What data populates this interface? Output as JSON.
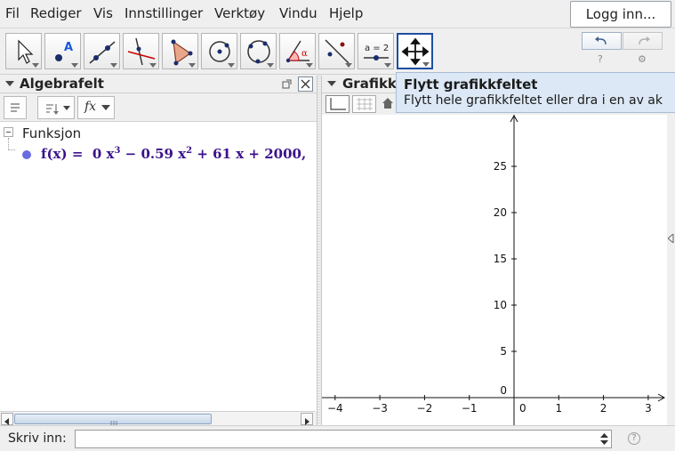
{
  "menubar": {
    "items": [
      "Fil",
      "Rediger",
      "Vis",
      "Innstillinger",
      "Verktøy",
      "Vindu",
      "Hjelp"
    ],
    "login_label": "Logg inn..."
  },
  "toolbar": {
    "tools": [
      {
        "name": "move-tool",
        "icon": "arrow-pointer-icon"
      },
      {
        "name": "point-tool",
        "icon": "point-A-icon"
      },
      {
        "name": "line-tool",
        "icon": "line-through-points-icon"
      },
      {
        "name": "perpendicular-tool",
        "icon": "perpendicular-line-icon"
      },
      {
        "name": "polygon-tool",
        "icon": "polygon-icon"
      },
      {
        "name": "circle-center-tool",
        "icon": "circle-center-point-icon"
      },
      {
        "name": "circle-three-points-tool",
        "icon": "circle-three-points-icon"
      },
      {
        "name": "angle-tool",
        "icon": "angle-alpha-icon"
      },
      {
        "name": "reflect-tool",
        "icon": "reflect-about-line-icon"
      },
      {
        "name": "slider-tool",
        "icon": "slider-a-equals-2-icon",
        "label": "a = 2"
      },
      {
        "name": "move-graphics-view-tool",
        "icon": "move-arrows-icon",
        "selected": true
      }
    ],
    "help_icon": "?",
    "settings_icon": "⚙"
  },
  "algebra": {
    "title": "Algebrafelt",
    "category": "Funksjon",
    "formula": {
      "lhs": "f(x)",
      "eq": "=",
      "t1": "0 x",
      "t1_exp": "3",
      "t2": "− 0.59 x",
      "t2_exp": "2",
      "t3": "+ 61 x + 2000,"
    },
    "fx_label": "fx"
  },
  "graphics": {
    "title": "Grafikk",
    "x_ticks": [
      "-4",
      "-3",
      "-2",
      "-1",
      "0",
      "1",
      "2",
      "3"
    ],
    "y_ticks": [
      "25",
      "20",
      "15",
      "10",
      "5",
      "0"
    ]
  },
  "tooltip": {
    "title": "Flytt grafikkfeltet",
    "description": "Flytt hele grafikkfeltet eller dra i en av ak"
  },
  "inputbar": {
    "label": "Skriv inn:",
    "value": "",
    "help": "?"
  },
  "colors": {
    "selected_tool_border": "#1d4ea3",
    "formula_color": "#3b128a",
    "tooltip_bg": "#dce8f5"
  }
}
